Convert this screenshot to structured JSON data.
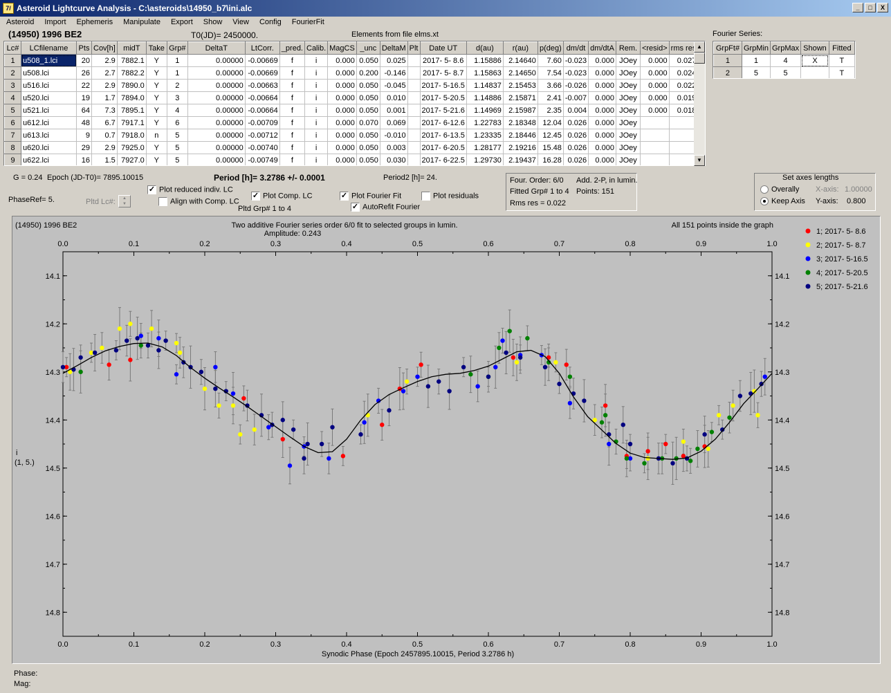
{
  "window": {
    "title": "Asteroid Lightcurve Analysis - C:\\asteroids\\14950_b7\\ini.alc",
    "app_icon": "7/",
    "btn_min": "_",
    "btn_max": "□",
    "btn_close": "X"
  },
  "menu": [
    "Asteroid",
    "Import",
    "Ephemeris",
    "Manipulate",
    "Export",
    "Show",
    "View",
    "Config",
    "FourierFit"
  ],
  "header": {
    "asteroid": "(14950) 1996 BE2",
    "t0": "T0(JD)= 2450000.",
    "elements": "Elements from file elms.xt",
    "fourier_label": "Fourier Series:"
  },
  "lc_table": {
    "columns": [
      "Lc#",
      "LCfilename",
      "Pts",
      "Cov[h]",
      "midT",
      "Take",
      "Grp#",
      "DeltaT",
      "LtCorr.",
      "_pred.",
      "Calib.",
      "MagCS",
      "_unc",
      "DeltaM",
      "Plt",
      "Date UT",
      "d(au)",
      "r(au)",
      "p(deg)",
      "dm/dt",
      "dm/dtA",
      "Rem.",
      "<resid>",
      "rms res"
    ],
    "rows": [
      [
        "1",
        "u508_1.lci",
        "20",
        "2.9",
        "7882.1",
        "Y",
        "1",
        "0.00000",
        "-0.00669",
        "f",
        "i",
        "0.000",
        "0.050",
        "0.025",
        "",
        "2017- 5- 8.6",
        "1.15886",
        "2.14640",
        "7.60",
        "-0.023",
        "0.000",
        "JOey",
        "0.000",
        "0.027"
      ],
      [
        "2",
        "u508.lci",
        "26",
        "2.7",
        "7882.2",
        "Y",
        "1",
        "0.00000",
        "-0.00669",
        "f",
        "i",
        "0.000",
        "0.200",
        "-0.146",
        "",
        "2017- 5- 8.7",
        "1.15863",
        "2.14650",
        "7.54",
        "-0.023",
        "0.000",
        "JOey",
        "0.000",
        "0.024"
      ],
      [
        "3",
        "u516.lci",
        "22",
        "2.9",
        "7890.0",
        "Y",
        "2",
        "0.00000",
        "-0.00663",
        "f",
        "i",
        "0.000",
        "0.050",
        "-0.045",
        "",
        "2017- 5-16.5",
        "1.14837",
        "2.15453",
        "3.66",
        "-0.026",
        "0.000",
        "JOey",
        "0.000",
        "0.022"
      ],
      [
        "4",
        "u520.lci",
        "19",
        "1.7",
        "7894.0",
        "Y",
        "3",
        "0.00000",
        "-0.00664",
        "f",
        "i",
        "0.000",
        "0.050",
        "0.010",
        "",
        "2017- 5-20.5",
        "1.14886",
        "2.15871",
        "2.41",
        "-0.007",
        "0.000",
        "JOey",
        "0.000",
        "0.019"
      ],
      [
        "5",
        "u521.lci",
        "64",
        "7.3",
        "7895.1",
        "Y",
        "4",
        "0.00000",
        "-0.00664",
        "f",
        "i",
        "0.000",
        "0.050",
        "0.001",
        "",
        "2017- 5-21.6",
        "1.14969",
        "2.15987",
        "2.35",
        "0.004",
        "0.000",
        "JOey",
        "0.000",
        "0.018"
      ],
      [
        "6",
        "u612.lci",
        "48",
        "6.7",
        "7917.1",
        "Y",
        "6",
        "0.00000",
        "-0.00709",
        "f",
        "i",
        "0.000",
        "0.070",
        "0.069",
        "",
        "2017- 6-12.6",
        "1.22783",
        "2.18348",
        "12.04",
        "0.026",
        "0.000",
        "JOey",
        "",
        ""
      ],
      [
        "7",
        "u613.lci",
        "9",
        "0.7",
        "7918.0",
        "n",
        "5",
        "0.00000",
        "-0.00712",
        "f",
        "i",
        "0.000",
        "0.050",
        "-0.010",
        "",
        "2017- 6-13.5",
        "1.23335",
        "2.18446",
        "12.45",
        "0.026",
        "0.000",
        "JOey",
        "",
        ""
      ],
      [
        "8",
        "u620.lci",
        "29",
        "2.9",
        "7925.0",
        "Y",
        "5",
        "0.00000",
        "-0.00740",
        "f",
        "i",
        "0.000",
        "0.050",
        "0.003",
        "",
        "2017- 6-20.5",
        "1.28177",
        "2.19216",
        "15.48",
        "0.026",
        "0.000",
        "JOey",
        "",
        ""
      ],
      [
        "9",
        "u622.lci",
        "16",
        "1.5",
        "7927.0",
        "Y",
        "5",
        "0.00000",
        "-0.00749",
        "f",
        "i",
        "0.000",
        "0.050",
        "0.030",
        "",
        "2017- 6-22.5",
        "1.29730",
        "2.19437",
        "16.28",
        "0.026",
        "0.000",
        "JOey",
        "",
        ""
      ]
    ]
  },
  "fourier_table": {
    "columns": [
      "GrpFt#",
      "GrpMin",
      "GrpMax",
      "Shown",
      "Fitted"
    ],
    "rows": [
      [
        "1",
        "1",
        "4",
        "X",
        "T"
      ],
      [
        "2",
        "5",
        "5",
        "",
        "T"
      ]
    ]
  },
  "controls": {
    "g": "G = 0.24",
    "epoch": "Epoch (JD-T0)= 7895.10015",
    "period": "Period [h]= 3.2786 +/- 0.0001",
    "period2": "Period2 [h]= 24.",
    "phaseref": "PhaseRef= 5.",
    "pltd_lc": "Pltd Lc#:",
    "plot_reduced": "Plot reduced indiv. LC",
    "align_comp": "Align with Comp. LC",
    "plot_comp": "Plot Comp. LC",
    "pltd_grp": "Pltd Grp#  1   to   4",
    "plot_fourier": "Plot Fourier Fit",
    "autorefit": "AutoRefit Fourier",
    "plot_residuals": "Plot residuals",
    "check_mark": "✓"
  },
  "fit_info": {
    "order": "Four. Order:  6/0",
    "add": "Add. 2-P, in lumin.",
    "fitted": "Fitted Grp# 1 to 4",
    "points": "Points: 151",
    "rms": "Rms res     = 0.022"
  },
  "axes_box": {
    "title": "Set axes lengths",
    "overally": "Overally",
    "keep_axis": "Keep Axis",
    "x_axis_label": "X-axis:",
    "x_axis_value": "1.00000",
    "y_axis_label": "Y-axis:",
    "y_axis_value": "0.800"
  },
  "status": {
    "phase": "Phase:",
    "mag": "Mag:"
  },
  "chart_data": {
    "type": "scatter",
    "title_left": "(14950) 1996 BE2",
    "title_center": "Two additive Fourier series order 6/0 fit to selected groups in lumin.",
    "amplitude": "Amplitude: 0.243",
    "title_right": "All 151 points inside the graph",
    "xlabel": "Synodic Phase (Epoch 2457895.10015, Period 3.2786 h)",
    "ylabel_line1": "i",
    "ylabel_line2": "(1, 5.)",
    "xlim": [
      0,
      1
    ],
    "ylim": [
      14.05,
      14.85
    ],
    "y_inverted": true,
    "x_ticks": [
      "0.0",
      "0.1",
      "0.2",
      "0.3",
      "0.4",
      "0.5",
      "0.6",
      "0.7",
      "0.8",
      "0.9",
      "1.0"
    ],
    "y_ticks": [
      "14.1",
      "14.2",
      "14.3",
      "14.4",
      "14.5",
      "14.6",
      "14.7",
      "14.8"
    ],
    "legend_placement": "right",
    "fourier_curve": [
      [
        0.0,
        14.303
      ],
      [
        0.02,
        14.287
      ],
      [
        0.04,
        14.27
      ],
      [
        0.06,
        14.256
      ],
      [
        0.08,
        14.247
      ],
      [
        0.1,
        14.241
      ],
      [
        0.12,
        14.24
      ],
      [
        0.14,
        14.248
      ],
      [
        0.16,
        14.266
      ],
      [
        0.18,
        14.291
      ],
      [
        0.2,
        14.313
      ],
      [
        0.22,
        14.333
      ],
      [
        0.24,
        14.352
      ],
      [
        0.26,
        14.372
      ],
      [
        0.28,
        14.393
      ],
      [
        0.3,
        14.414
      ],
      [
        0.32,
        14.435
      ],
      [
        0.34,
        14.455
      ],
      [
        0.36,
        14.468
      ],
      [
        0.38,
        14.466
      ],
      [
        0.4,
        14.44
      ],
      [
        0.42,
        14.4
      ],
      [
        0.44,
        14.368
      ],
      [
        0.46,
        14.347
      ],
      [
        0.48,
        14.333
      ],
      [
        0.5,
        14.32
      ],
      [
        0.52,
        14.31
      ],
      [
        0.54,
        14.305
      ],
      [
        0.56,
        14.303
      ],
      [
        0.58,
        14.297
      ],
      [
        0.6,
        14.288
      ],
      [
        0.62,
        14.273
      ],
      [
        0.64,
        14.258
      ],
      [
        0.66,
        14.255
      ],
      [
        0.68,
        14.268
      ],
      [
        0.7,
        14.303
      ],
      [
        0.72,
        14.352
      ],
      [
        0.74,
        14.393
      ],
      [
        0.76,
        14.421
      ],
      [
        0.78,
        14.449
      ],
      [
        0.8,
        14.469
      ],
      [
        0.82,
        14.478
      ],
      [
        0.84,
        14.48
      ],
      [
        0.86,
        14.482
      ],
      [
        0.88,
        14.479
      ],
      [
        0.9,
        14.465
      ],
      [
        0.92,
        14.44
      ],
      [
        0.94,
        14.405
      ],
      [
        0.96,
        14.366
      ],
      [
        0.98,
        14.335
      ],
      [
        1.0,
        14.303
      ]
    ],
    "series": [
      {
        "name": "1; 2017- 5- 8.6",
        "color": "#ff0000",
        "points": [
          [
            0.005,
            14.29
          ],
          [
            0.065,
            14.285
          ],
          [
            0.095,
            14.275
          ],
          [
            0.255,
            14.355
          ],
          [
            0.31,
            14.44
          ],
          [
            0.395,
            14.475
          ],
          [
            0.45,
            14.41
          ],
          [
            0.475,
            14.335
          ],
          [
            0.505,
            14.285
          ],
          [
            0.635,
            14.27
          ],
          [
            0.685,
            14.27
          ],
          [
            0.71,
            14.285
          ],
          [
            0.765,
            14.37
          ],
          [
            0.795,
            14.475
          ],
          [
            0.825,
            14.465
          ],
          [
            0.85,
            14.45
          ],
          [
            0.875,
            14.475
          ],
          [
            0.905,
            14.455
          ]
        ]
      },
      {
        "name": "2; 2017- 5- 8.7",
        "color": "#ffff00",
        "points": [
          [
            0.01,
            14.3
          ],
          [
            0.04,
            14.26
          ],
          [
            0.055,
            14.25
          ],
          [
            0.08,
            14.21
          ],
          [
            0.095,
            14.2
          ],
          [
            0.125,
            14.21
          ],
          [
            0.16,
            14.24
          ],
          [
            0.165,
            14.26
          ],
          [
            0.2,
            14.335
          ],
          [
            0.22,
            14.37
          ],
          [
            0.24,
            14.37
          ],
          [
            0.25,
            14.43
          ],
          [
            0.27,
            14.42
          ],
          [
            0.43,
            14.39
          ],
          [
            0.485,
            14.32
          ],
          [
            0.64,
            14.28
          ],
          [
            0.695,
            14.28
          ],
          [
            0.75,
            14.4
          ],
          [
            0.825,
            14.48
          ],
          [
            0.875,
            14.445
          ],
          [
            0.91,
            14.46
          ],
          [
            0.925,
            14.39
          ],
          [
            0.945,
            14.37
          ],
          [
            0.975,
            14.34
          ],
          [
            0.98,
            14.39
          ]
        ]
      },
      {
        "name": "3; 2017- 5-16.5",
        "color": "#0000ff",
        "points": [
          [
            0.11,
            14.225
          ],
          [
            0.135,
            14.23
          ],
          [
            0.16,
            14.305
          ],
          [
            0.215,
            14.29
          ],
          [
            0.24,
            14.345
          ],
          [
            0.29,
            14.415
          ],
          [
            0.32,
            14.495
          ],
          [
            0.34,
            14.455
          ],
          [
            0.375,
            14.48
          ],
          [
            0.425,
            14.405
          ],
          [
            0.445,
            14.36
          ],
          [
            0.48,
            14.34
          ],
          [
            0.5,
            14.31
          ],
          [
            0.585,
            14.33
          ],
          [
            0.61,
            14.29
          ],
          [
            0.62,
            14.235
          ],
          [
            0.645,
            14.265
          ],
          [
            0.675,
            14.265
          ],
          [
            0.715,
            14.365
          ],
          [
            0.77,
            14.45
          ],
          [
            0.8,
            14.48
          ],
          [
            0.99,
            14.31
          ]
        ]
      },
      {
        "name": "4; 2017- 5-20.5",
        "color": "#008000",
        "points": [
          [
            0.025,
            14.3
          ],
          [
            0.11,
            14.245
          ],
          [
            0.575,
            14.305
          ],
          [
            0.6,
            14.31
          ],
          [
            0.615,
            14.25
          ],
          [
            0.63,
            14.215
          ],
          [
            0.655,
            14.23
          ],
          [
            0.685,
            14.28
          ],
          [
            0.715,
            14.31
          ],
          [
            0.76,
            14.405
          ],
          [
            0.765,
            14.39
          ],
          [
            0.78,
            14.445
          ],
          [
            0.795,
            14.48
          ],
          [
            0.82,
            14.49
          ],
          [
            0.845,
            14.48
          ],
          [
            0.865,
            14.48
          ],
          [
            0.885,
            14.485
          ],
          [
            0.895,
            14.46
          ],
          [
            0.915,
            14.425
          ],
          [
            0.94,
            14.395
          ]
        ]
      },
      {
        "name": "5; 2017- 5-21.6",
        "color": "#000080",
        "points": [
          [
            0.0,
            14.29
          ],
          [
            0.015,
            14.295
          ],
          [
            0.025,
            14.27
          ],
          [
            0.045,
            14.26
          ],
          [
            0.075,
            14.255
          ],
          [
            0.09,
            14.235
          ],
          [
            0.105,
            14.23
          ],
          [
            0.12,
            14.245
          ],
          [
            0.135,
            14.255
          ],
          [
            0.145,
            14.235
          ],
          [
            0.17,
            14.28
          ],
          [
            0.18,
            14.29
          ],
          [
            0.195,
            14.3
          ],
          [
            0.215,
            14.335
          ],
          [
            0.23,
            14.34
          ],
          [
            0.26,
            14.37
          ],
          [
            0.28,
            14.39
          ],
          [
            0.295,
            14.41
          ],
          [
            0.31,
            14.4
          ],
          [
            0.325,
            14.42
          ],
          [
            0.34,
            14.48
          ],
          [
            0.345,
            14.45
          ],
          [
            0.365,
            14.45
          ],
          [
            0.38,
            14.415
          ],
          [
            0.42,
            14.43
          ],
          [
            0.46,
            14.38
          ],
          [
            0.515,
            14.33
          ],
          [
            0.53,
            14.32
          ],
          [
            0.545,
            14.34
          ],
          [
            0.565,
            14.29
          ],
          [
            0.6,
            14.31
          ],
          [
            0.625,
            14.26
          ],
          [
            0.645,
            14.27
          ],
          [
            0.68,
            14.29
          ],
          [
            0.7,
            14.325
          ],
          [
            0.72,
            14.345
          ],
          [
            0.735,
            14.36
          ],
          [
            0.77,
            14.43
          ],
          [
            0.79,
            14.41
          ],
          [
            0.8,
            14.45
          ],
          [
            0.84,
            14.48
          ],
          [
            0.86,
            14.49
          ],
          [
            0.88,
            14.48
          ],
          [
            0.905,
            14.43
          ],
          [
            0.93,
            14.42
          ],
          [
            0.955,
            14.35
          ],
          [
            0.97,
            14.345
          ],
          [
            0.985,
            14.325
          ]
        ]
      }
    ]
  }
}
